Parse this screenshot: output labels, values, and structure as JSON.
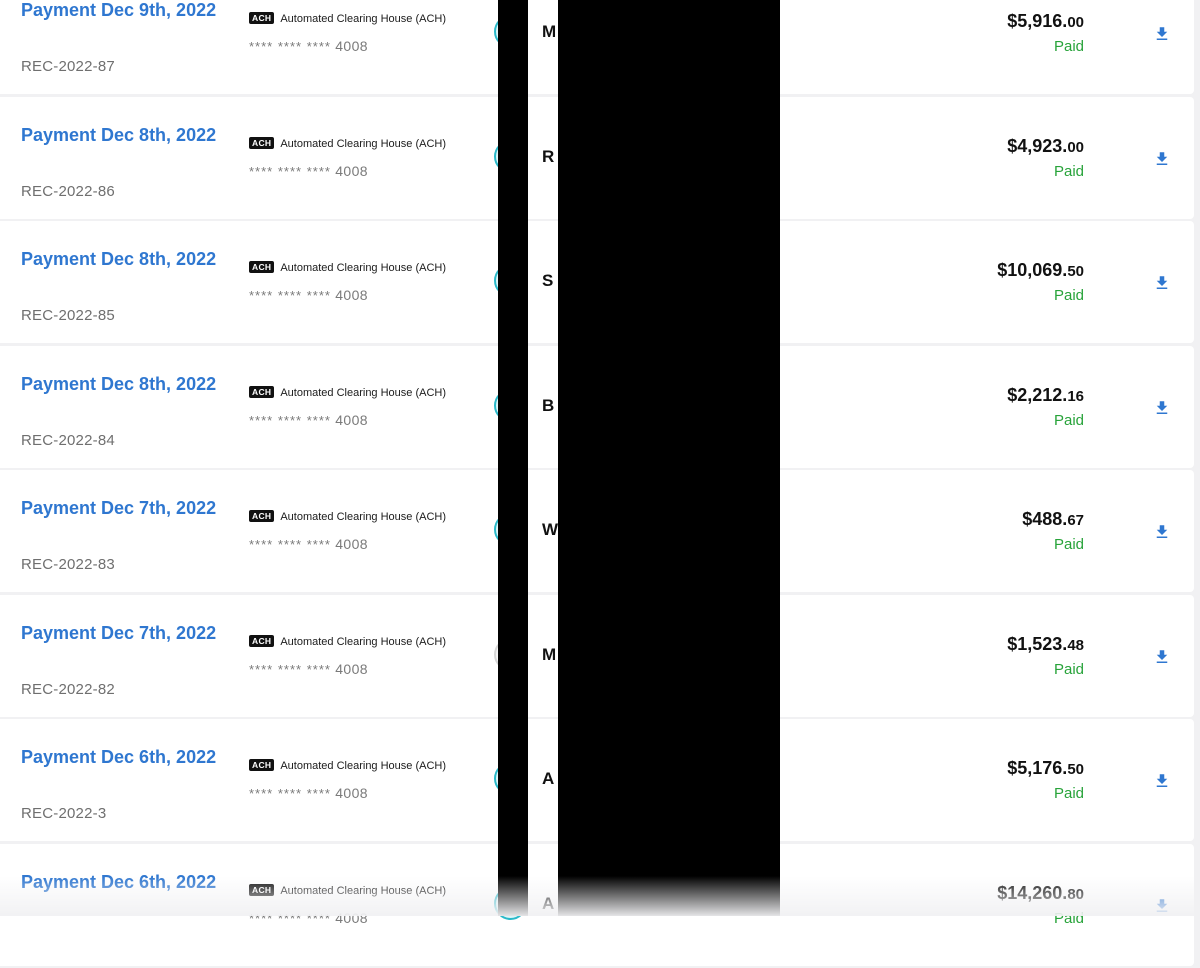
{
  "download_icon": "download-icon",
  "colors": {
    "title_link": "#2f77d0",
    "paid": "#28a33a",
    "avatar_ring": "#2bb9c9"
  },
  "payments": [
    {
      "title": "Payment Dec 9th, 2022",
      "ref": "REC-2022-87",
      "badge": "ACH",
      "method": "Automated Clearing House (ACH)",
      "mask": "**** **** ****",
      "last4": "4008",
      "payee": "M",
      "amount_main": "$5,916.",
      "amount_cents": "00",
      "status": "Paid"
    },
    {
      "title": "Payment Dec 8th, 2022",
      "ref": "REC-2022-86",
      "badge": "ACH",
      "method": "Automated Clearing House (ACH)",
      "mask": "**** **** ****",
      "last4": "4008",
      "payee": "R",
      "amount_main": "$4,923.",
      "amount_cents": "00",
      "status": "Paid"
    },
    {
      "title": "Payment Dec 8th, 2022",
      "ref": "REC-2022-85",
      "badge": "ACH",
      "method": "Automated Clearing House (ACH)",
      "mask": "**** **** ****",
      "last4": "4008",
      "payee": "S",
      "amount_main": "$10,069.",
      "amount_cents": "50",
      "status": "Paid"
    },
    {
      "title": "Payment Dec 8th, 2022",
      "ref": "REC-2022-84",
      "badge": "ACH",
      "method": "Automated Clearing House (ACH)",
      "mask": "**** **** ****",
      "last4": "4008",
      "payee": "B",
      "amount_main": "$2,212.",
      "amount_cents": "16",
      "status": "Paid"
    },
    {
      "title": "Payment Dec 7th, 2022",
      "ref": "REC-2022-83",
      "badge": "ACH",
      "method": "Automated Clearing House (ACH)",
      "mask": "**** **** ****",
      "last4": "4008",
      "payee": "W",
      "amount_main": "$488.",
      "amount_cents": "67",
      "status": "Paid"
    },
    {
      "title": "Payment Dec 7th, 2022",
      "ref": "REC-2022-82",
      "badge": "ACH",
      "method": "Automated Clearing House (ACH)",
      "mask": "**** **** ****",
      "last4": "4008",
      "payee": "M",
      "amount_main": "$1,523.",
      "amount_cents": "48",
      "status": "Paid"
    },
    {
      "title": "Payment Dec 6th, 2022",
      "ref": "REC-2022-3",
      "badge": "ACH",
      "method": "Automated Clearing House (ACH)",
      "mask": "**** **** ****",
      "last4": "4008",
      "payee": "A",
      "amount_main": "$5,176.",
      "amount_cents": "50",
      "status": "Paid"
    },
    {
      "title": "Payment Dec 6th, 2022",
      "ref": "",
      "badge": "ACH",
      "method": "Automated Clearing House (ACH)",
      "mask": "**** **** ****",
      "last4": "4008",
      "payee": "A",
      "amount_main": "$14,260.",
      "amount_cents": "80",
      "status": "Paid"
    }
  ]
}
